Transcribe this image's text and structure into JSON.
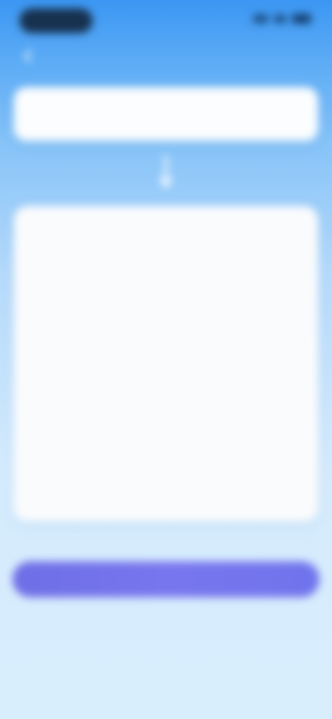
{
  "status_bar": {
    "time": "",
    "icons": [
      "signal-icon",
      "wifi-icon",
      "battery-icon"
    ]
  },
  "nav": {
    "back_icon": "chevron-left-icon"
  },
  "prompt_card": {
    "label": "",
    "text": ""
  },
  "arrow_icon": "arrow-down-icon",
  "editor": {
    "title": "",
    "body": "",
    "highlight": ""
  },
  "primary_button": {
    "label": ""
  },
  "secondary_link": "",
  "footer_note": "",
  "colors": {
    "background_top": "#3b97f3",
    "background_bottom": "#d9eefd",
    "card": "#fafbfd",
    "button": "#7270ea",
    "status_pill": "#17314f"
  }
}
